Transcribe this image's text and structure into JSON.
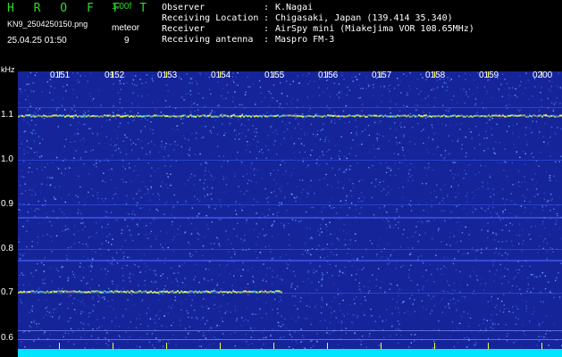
{
  "header": {
    "app_title": "H R O F F T",
    "version": "1.00f",
    "filename": "KN9_2504250150.png",
    "datetime": "25.04.25 01:50",
    "meteor_label": "meteor",
    "meteor_count": "9"
  },
  "info": [
    {
      "key": "Observer",
      "value": "K.Nagai"
    },
    {
      "key": "Receiving Location",
      "value": "Chigasaki, Japan (139.414 35.340)"
    },
    {
      "key": "Receiver",
      "value": "AirSpy mini (Miakejima VOR 108.65MHz)"
    },
    {
      "key": "Receiving antenna",
      "value": "Maspro FM-3"
    }
  ],
  "info_separator": ":",
  "spectrogram": {
    "unit_label": "kHz",
    "y_ticks": [
      "1.1",
      "1.0",
      "0.9",
      "0.8",
      "0.7",
      "0.6"
    ],
    "x_ticks": [
      "0151",
      "0152",
      "0153",
      "0154",
      "0155",
      "0156",
      "0157",
      "0158",
      "0159",
      "0200"
    ],
    "colors": {
      "background": "#16249a",
      "noise": "#3a7bff",
      "signal": "#f5ff4a",
      "floor": "#00e5ff"
    }
  }
}
